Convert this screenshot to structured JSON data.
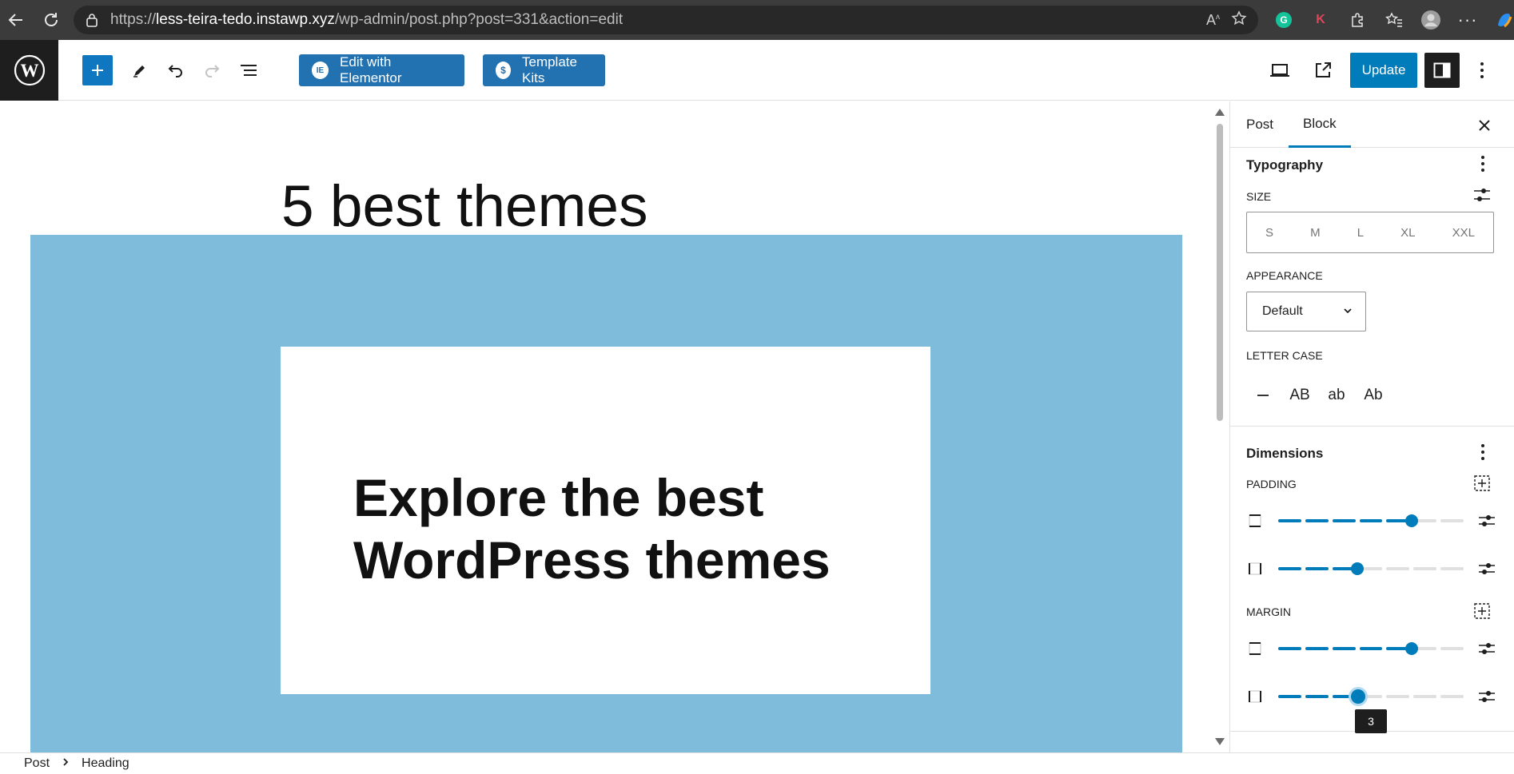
{
  "browser": {
    "url_prefix": "https://",
    "url_host": "less-teira-tedo.instawp.xyz",
    "url_path": "/wp-admin/post.php?post=331&action=edit"
  },
  "toolbar": {
    "edit_elementor_label": "Edit with Elementor",
    "template_kits_label": "Template Kits",
    "update_label": "Update"
  },
  "canvas": {
    "post_title": "5 best themes",
    "cover_heading_line1": "Explore the best",
    "cover_heading_line2": "WordPress themes"
  },
  "sidebar": {
    "tabs": [
      {
        "label": "Post"
      },
      {
        "label": "Block"
      }
    ],
    "active_tab": "Block",
    "typography": {
      "title": "Typography",
      "size_label": "SIZE",
      "sizes": [
        "S",
        "M",
        "L",
        "XL",
        "XXL"
      ],
      "appearance_label": "APPEARANCE",
      "appearance_value": "Default",
      "letter_case_label": "LETTER CASE",
      "letter_cases": [
        "AB",
        "ab",
        "Ab"
      ]
    },
    "dimensions": {
      "title": "Dimensions",
      "padding_label": "PADDING",
      "margin_label": "MARGIN",
      "padding_vertical_value": 5,
      "padding_horizontal_value": 3,
      "margin_vertical_value": 5,
      "margin_horizontal_value": 3,
      "steps_max": 7,
      "tooltip_value": "3"
    }
  },
  "footer": {
    "breadcrumb": [
      "Post",
      "Heading"
    ]
  },
  "colors": {
    "wp_blue": "#007cba",
    "cover_bg": "#7fbcdc",
    "elementor_blue": "#2271b1"
  }
}
